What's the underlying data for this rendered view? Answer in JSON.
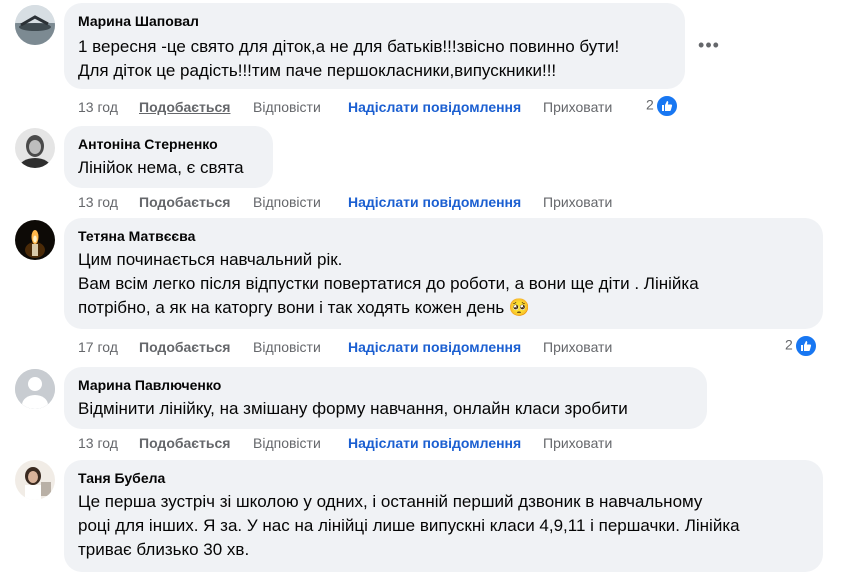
{
  "comments": [
    {
      "author": "Марина Шаповал",
      "lines": [
        "1 вересня -це свято для діток,а не для батьків!!!звісно повинно бути!",
        "Для діток це радість!!!тим паче першокласники,випускники!!!"
      ],
      "time": "13 год",
      "like": "Подобається",
      "reply": "Відповісти",
      "send": "Надіслати повідомлення",
      "hide": "Приховати",
      "likes": "2"
    },
    {
      "author": "Антоніна Стерненко",
      "lines": [
        "Лінійок нема, є свята"
      ],
      "time": "13 год",
      "like": "Подобається",
      "reply": "Відповісти",
      "send": "Надіслати повідомлення",
      "hide": "Приховати"
    },
    {
      "author": "Тетяна Матвєєва",
      "lines": [
        "Цим починається навчальний рік.",
        "Вам всім легко після відпустки повертатися до роботи, а вони ще діти . Лінійка",
        "потрібно, а як на каторгу вони і так ходять кожен день 🥺"
      ],
      "time": "17 год",
      "like": "Подобається",
      "reply": "Відповісти",
      "send": "Надіслати повідомлення",
      "hide": "Приховати",
      "likes": "2"
    },
    {
      "author": "Марина Павлюченко",
      "lines": [
        "Відмінити лінійку, на змішану форму навчання, онлайн класи зробити"
      ],
      "time": "13 год",
      "like": "Подобається",
      "reply": "Відповісти",
      "send": "Надіслати повідомлення",
      "hide": "Приховати"
    },
    {
      "author": "Таня Бубела",
      "lines": [
        "Це перша зустріч зі школою у одних, і останній перший дзвоник в навчальному",
        "році для інших. Я за. У нас на лінійці лише випускні класи 4,9,11 і першачки. Лінійка",
        "триває близько 30 хв."
      ]
    }
  ],
  "more_icon": "more-options-icon",
  "like_icon": "thumbs-up-icon",
  "colors": {
    "bubble": "#f0f2f5",
    "link": "#1b5fd1",
    "meta": "#65676b",
    "like": "#1877f2"
  }
}
